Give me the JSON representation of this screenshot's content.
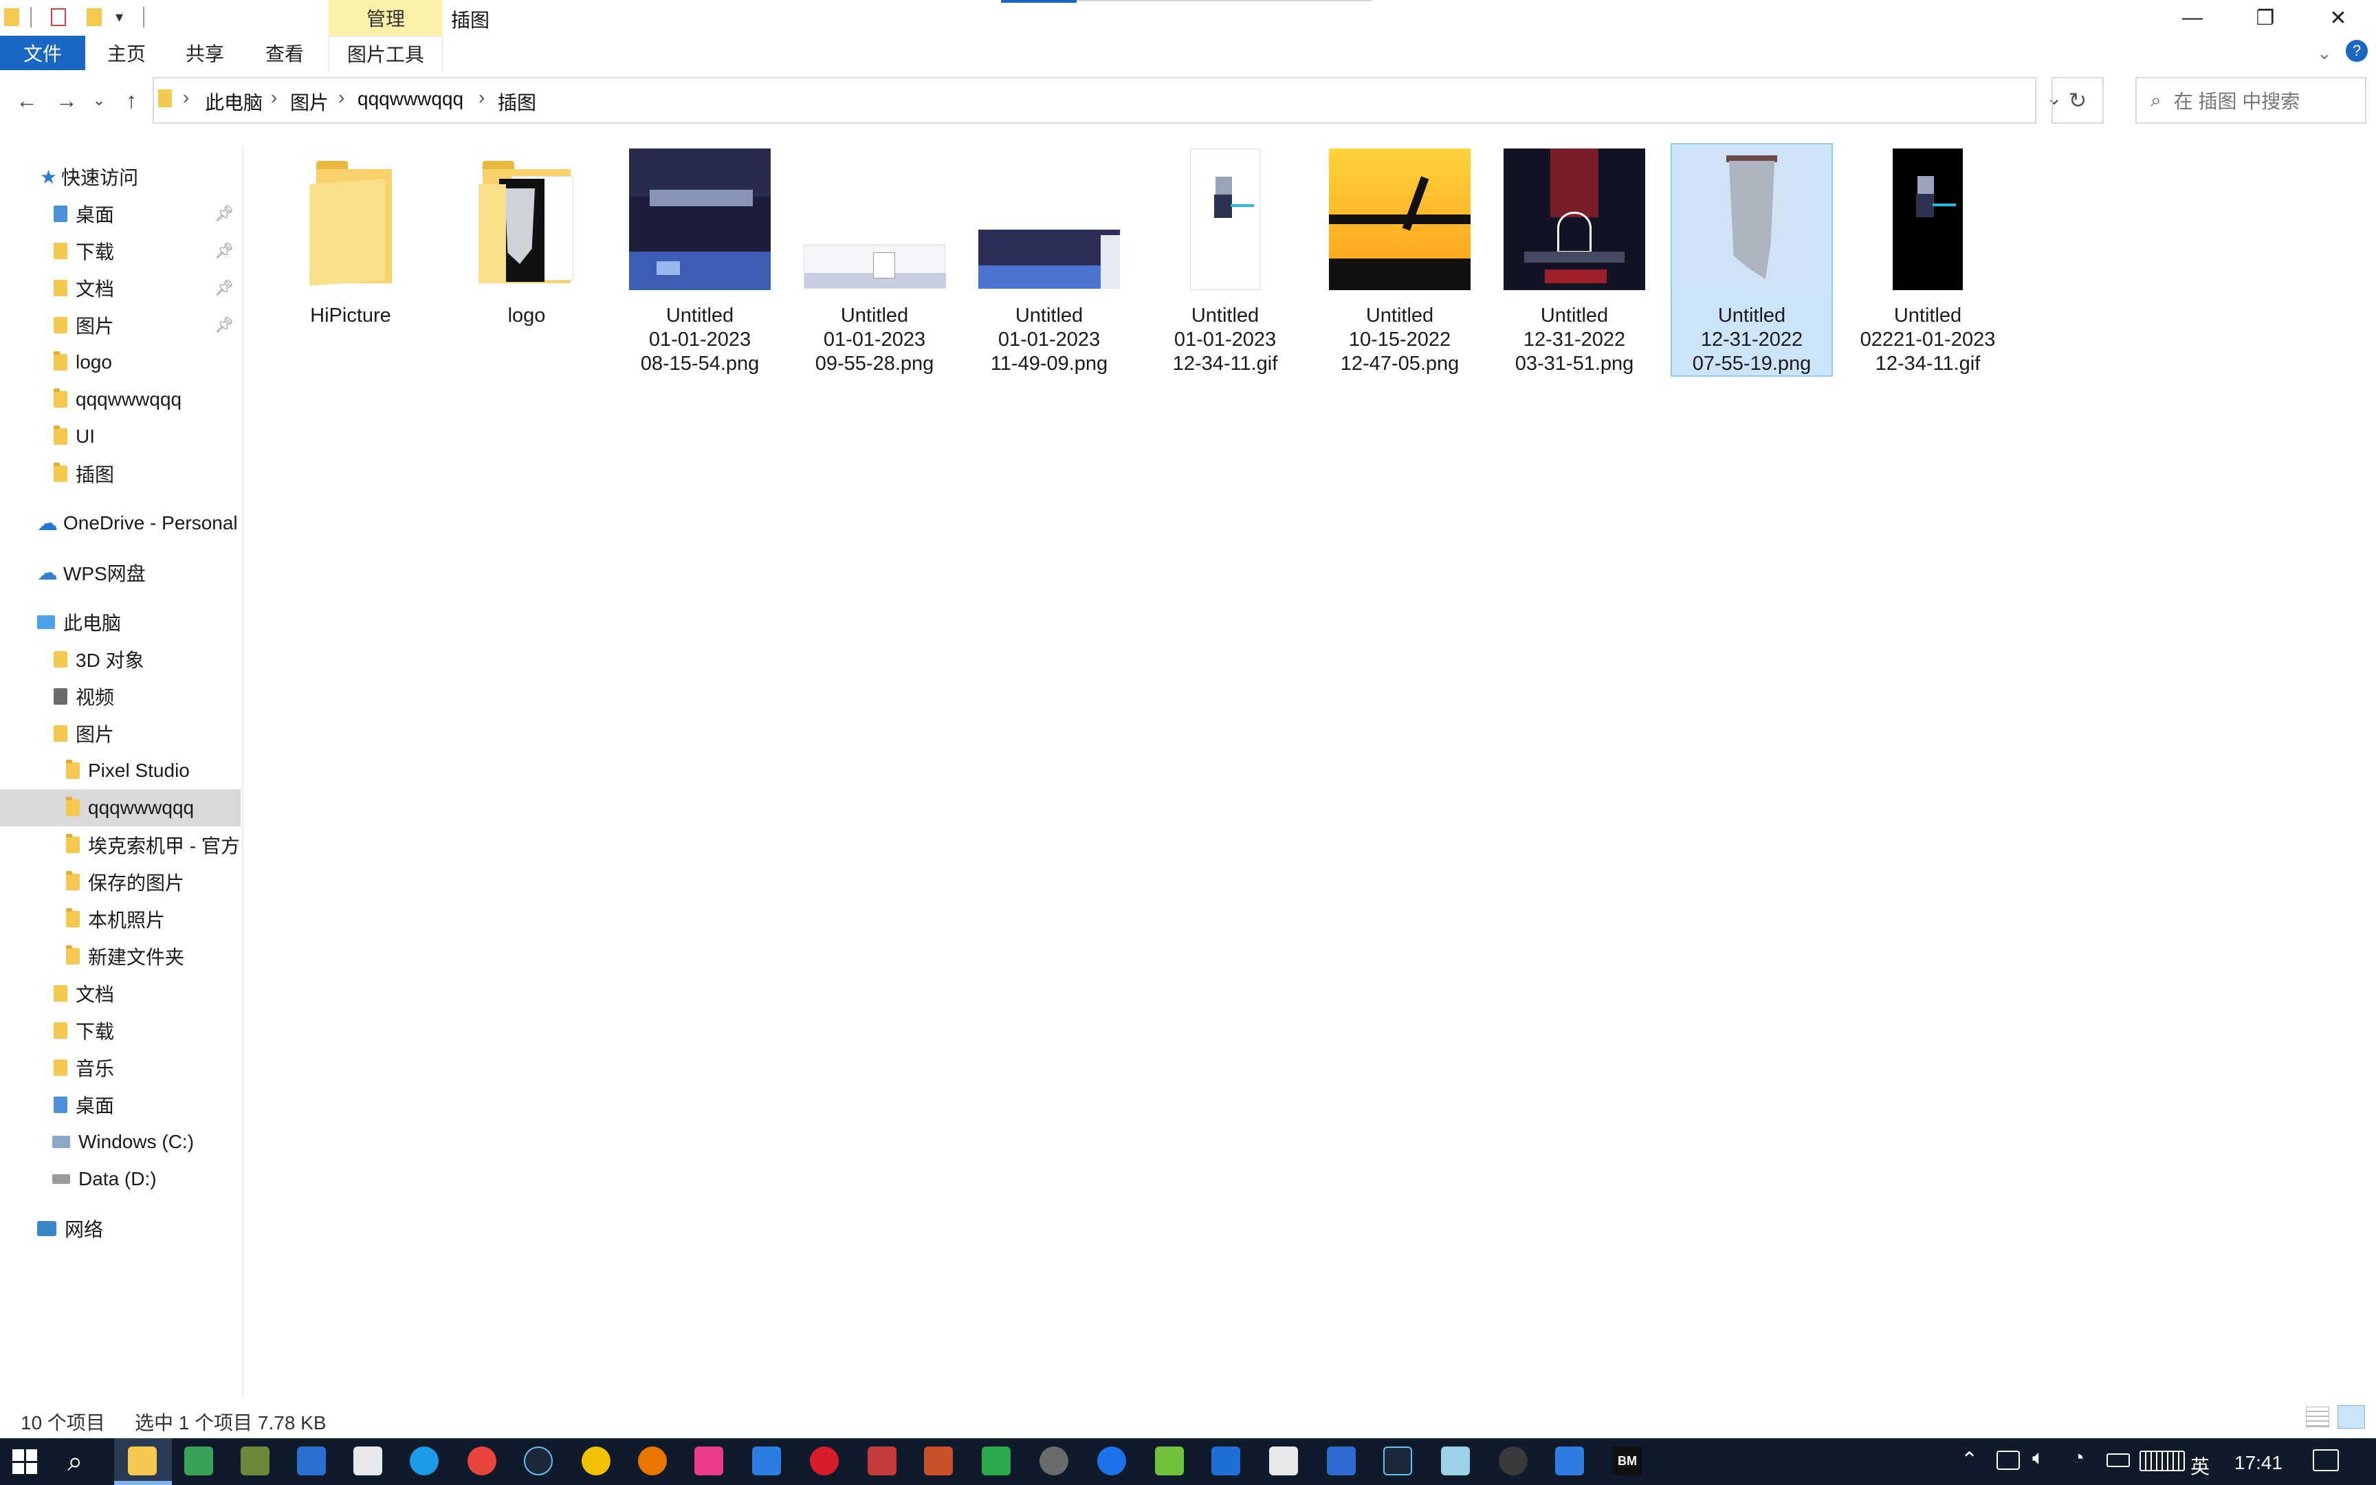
{
  "titlebar": {
    "context_tab": "管理",
    "window_title": "插图",
    "minimize": "—",
    "restore": "❐",
    "close": "✕"
  },
  "ribbon": {
    "tabs": [
      "文件",
      "主页",
      "共享",
      "查看",
      "图片工具"
    ]
  },
  "address": {
    "crumbs": [
      "此电脑",
      "图片",
      "qqqwwwqqq",
      "插图"
    ],
    "search_placeholder": "在 插图 中搜索"
  },
  "sidebar": {
    "items": [
      {
        "label": "快速访问"
      },
      {
        "label": "桌面"
      },
      {
        "label": "下载"
      },
      {
        "label": "文档"
      },
      {
        "label": "图片"
      },
      {
        "label": "logo"
      },
      {
        "label": "qqqwwwqqq"
      },
      {
        "label": "UI"
      },
      {
        "label": "插图"
      },
      {
        "label": "OneDrive - Personal"
      },
      {
        "label": "WPS网盘"
      },
      {
        "label": "此电脑"
      },
      {
        "label": "3D 对象"
      },
      {
        "label": "视频"
      },
      {
        "label": "图片"
      },
      {
        "label": "Pixel Studio"
      },
      {
        "label": "qqqwwwqqq"
      },
      {
        "label": "埃克索机甲 - 官方"
      },
      {
        "label": "保存的图片"
      },
      {
        "label": "本机照片"
      },
      {
        "label": "新建文件夹"
      },
      {
        "label": "文档"
      },
      {
        "label": "下载"
      },
      {
        "label": "音乐"
      },
      {
        "label": "桌面"
      },
      {
        "label": "Windows (C:)"
      },
      {
        "label": "Data (D:)"
      },
      {
        "label": "网络"
      }
    ]
  },
  "files": [
    {
      "line1": "HiPicture",
      "line2": "",
      "line3": ""
    },
    {
      "line1": "logo",
      "line2": "",
      "line3": ""
    },
    {
      "line1": "Untitled",
      "line2": "01-01-2023",
      "line3": "08-15-54.png"
    },
    {
      "line1": "Untitled",
      "line2": "01-01-2023",
      "line3": "09-55-28.png"
    },
    {
      "line1": "Untitled",
      "line2": "01-01-2023",
      "line3": "11-49-09.png"
    },
    {
      "line1": "Untitled",
      "line2": "01-01-2023",
      "line3": "12-34-11.gif"
    },
    {
      "line1": "Untitled",
      "line2": "10-15-2022",
      "line3": "12-47-05.png"
    },
    {
      "line1": "Untitled",
      "line2": "12-31-2022",
      "line3": "03-31-51.png"
    },
    {
      "line1": "Untitled",
      "line2": "12-31-2022",
      "line3": "07-55-19.png"
    },
    {
      "line1": "Untitled",
      "line2": "02221-01-2023",
      "line3": "12-34-11.gif"
    }
  ],
  "status": {
    "count": "10 个项目",
    "selection": "选中 1 个项目  7.78 KB"
  },
  "taskbar": {
    "ime": "英",
    "time": "17:41",
    "bm_label": "BM"
  },
  "colors": {
    "accent": "#1a66c4",
    "selection_bg": "#cce4f7",
    "context_tab": "#fbf1a8",
    "folder": "#f5c94f",
    "taskbar": "#0f1a2b"
  }
}
